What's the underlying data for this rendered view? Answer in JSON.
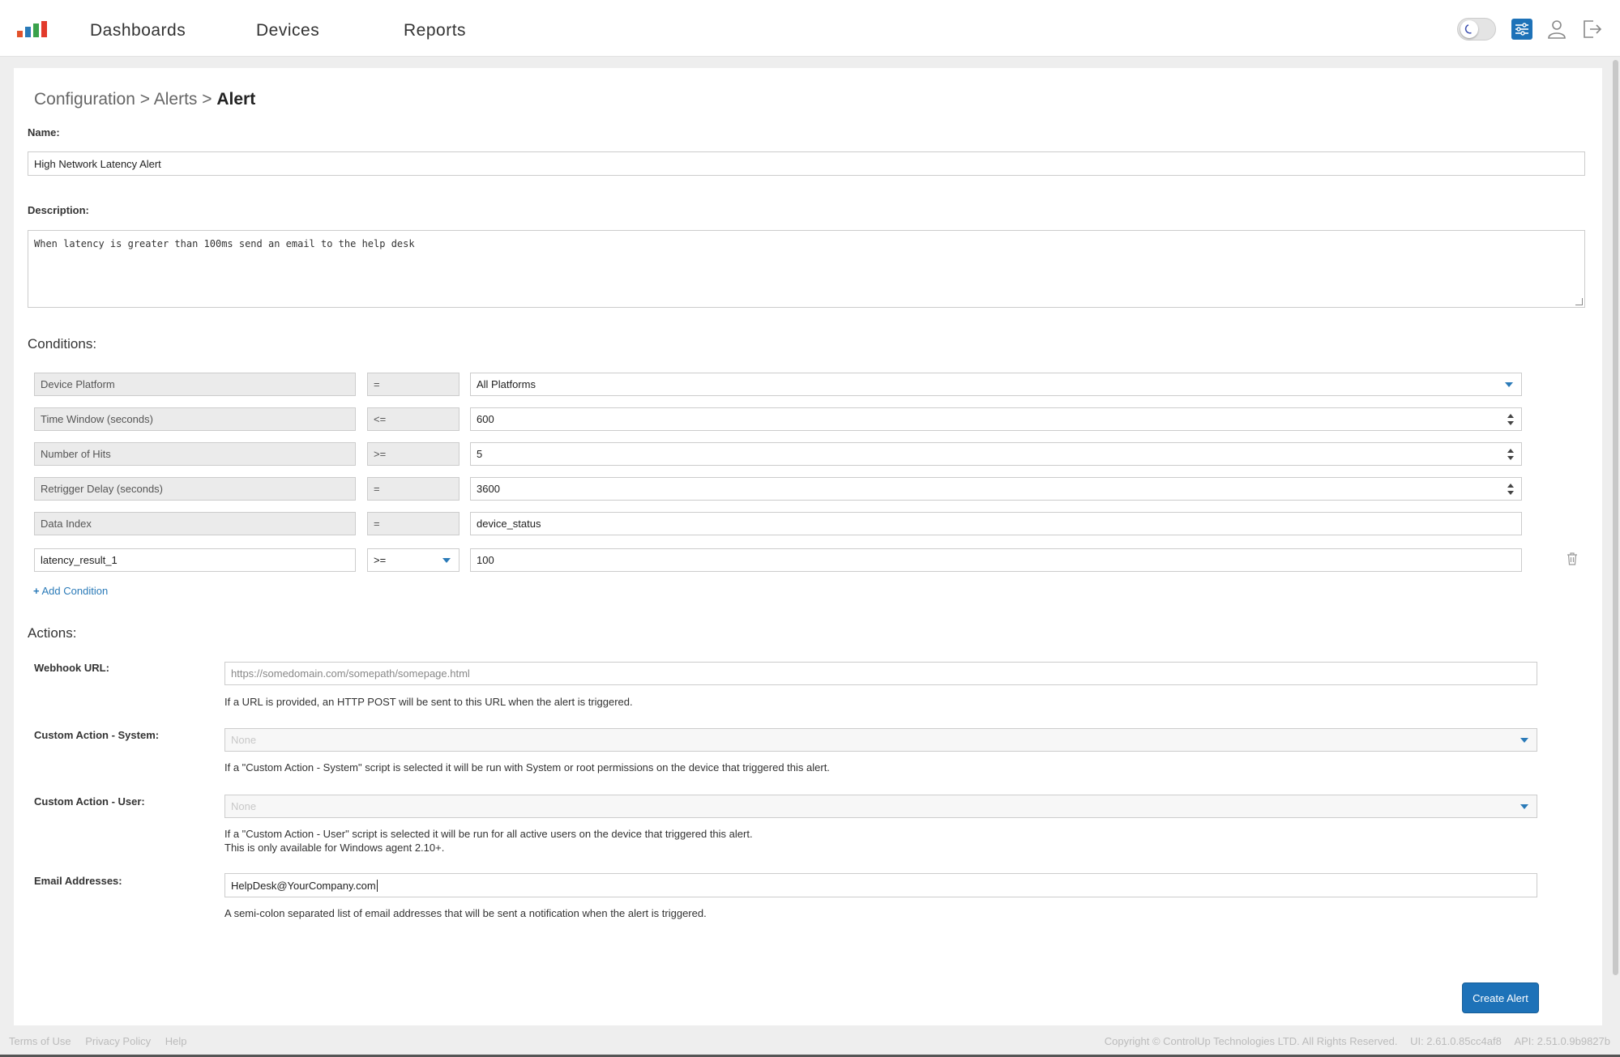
{
  "nav": {
    "links": [
      "Dashboards",
      "Devices",
      "Reports"
    ],
    "logo_colors": [
      "#e2522b",
      "#2a7ab8",
      "#3aa24b",
      "#e23a2b"
    ]
  },
  "breadcrumb": {
    "part1": "Configuration",
    "sep": ">",
    "part2": "Alerts",
    "current": "Alert"
  },
  "form": {
    "name_label": "Name:",
    "name_value": "High Network Latency Alert",
    "description_label": "Description:",
    "description_value": "When latency is greater than 100ms send an email to the help desk"
  },
  "conditions": {
    "heading": "Conditions:",
    "rows": [
      {
        "field": "Device Platform",
        "op": "=",
        "value": "All Platforms",
        "control": "select"
      },
      {
        "field": "Time Window (seconds)",
        "op": "<=",
        "value": "600",
        "control": "number"
      },
      {
        "field": "Number of Hits",
        "op": ">=",
        "value": "5",
        "control": "number"
      },
      {
        "field": "Retrigger Delay (seconds)",
        "op": "=",
        "value": "3600",
        "control": "number"
      },
      {
        "field": "Data Index",
        "op": "=",
        "value": "device_status",
        "control": "text"
      },
      {
        "field": "latency_result_1",
        "op": ">=",
        "value": "100",
        "control": "editable"
      }
    ],
    "add_label": "Add Condition"
  },
  "actions": {
    "heading": "Actions:",
    "webhook_label": "Webhook URL:",
    "webhook_placeholder": "https://somedomain.com/somepath/somepage.html",
    "webhook_help": "If a URL is provided, an HTTP POST will be sent to this URL when the alert is triggered.",
    "system_label": "Custom Action - System:",
    "system_value": "None",
    "system_help": "If a \"Custom Action - System\" script is selected it will be run with System or root permissions on the device that triggered this alert.",
    "user_label": "Custom Action - User:",
    "user_value": "None",
    "user_help_1": "If a \"Custom Action - User\" script is selected it will be run for all active users on the device that triggered this alert.",
    "user_help_2": "This is only available for Windows agent 2.10+.",
    "email_label": "Email Addresses:",
    "email_value": "HelpDesk@YourCompany.com",
    "email_help": "A semi-colon separated list of email addresses that will be sent a notification when the alert is triggered."
  },
  "create_button": "Create Alert",
  "footer": {
    "terms": "Terms of Use",
    "privacy": "Privacy Policy",
    "help": "Help",
    "copyright": "Copyright © ControlUp Technologies LTD. All Rights Reserved.",
    "ui_version": "UI: 2.61.0.85cc4af8",
    "api_version": "API: 2.51.0.9b9827b"
  }
}
